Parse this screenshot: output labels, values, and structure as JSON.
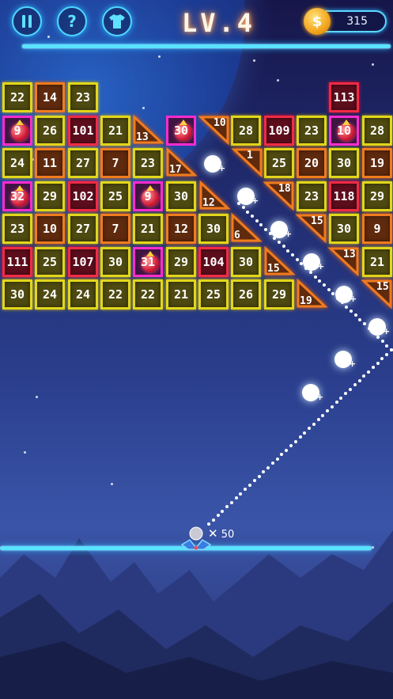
{
  "header": {
    "pause_icon": "pause-icon",
    "help_icon": "question-icon",
    "help_label": "?",
    "skins_icon": "tshirt-icon",
    "level_label": "LV.4",
    "coin_icon": "coin-icon",
    "coin_symbol": "$",
    "coins": "315"
  },
  "colors": {
    "neon_cyan": "#5ae3ff",
    "brick_yellow": "#e2d71b",
    "brick_orange": "#f07b1e",
    "brick_red": "#f02a45",
    "powerup_magenta": "#ff2bd0",
    "level_glow": "#ff7b2b"
  },
  "bricks": [
    {
      "v": "22",
      "k": "y"
    },
    {
      "v": "14",
      "k": "o"
    },
    {
      "v": "23",
      "k": "y"
    },
    {
      "v": "113",
      "k": "r"
    },
    {
      "v": "9",
      "k": "p"
    },
    {
      "v": "26",
      "k": "y"
    },
    {
      "v": "101",
      "k": "r"
    },
    {
      "v": "21",
      "k": "y"
    },
    {
      "v": "30",
      "k": "p"
    },
    {
      "v": "28",
      "k": "y"
    },
    {
      "v": "109",
      "k": "r"
    },
    {
      "v": "23",
      "k": "y"
    },
    {
      "v": "10",
      "k": "p"
    },
    {
      "v": "28",
      "k": "y"
    },
    {
      "v": "24",
      "k": "y"
    },
    {
      "v": "11",
      "k": "o"
    },
    {
      "v": "27",
      "k": "y"
    },
    {
      "v": "7",
      "k": "o"
    },
    {
      "v": "23",
      "k": "y"
    },
    {
      "v": "25",
      "k": "y"
    },
    {
      "v": "20",
      "k": "o"
    },
    {
      "v": "30",
      "k": "y"
    },
    {
      "v": "19",
      "k": "o"
    },
    {
      "v": "32",
      "k": "p"
    },
    {
      "v": "29",
      "k": "y"
    },
    {
      "v": "102",
      "k": "r"
    },
    {
      "v": "25",
      "k": "y"
    },
    {
      "v": "9",
      "k": "p"
    },
    {
      "v": "30",
      "k": "y"
    },
    {
      "v": "23",
      "k": "y"
    },
    {
      "v": "118",
      "k": "r"
    },
    {
      "v": "29",
      "k": "y"
    },
    {
      "v": "23",
      "k": "y"
    },
    {
      "v": "10",
      "k": "o"
    },
    {
      "v": "27",
      "k": "y"
    },
    {
      "v": "7",
      "k": "o"
    },
    {
      "v": "21",
      "k": "y"
    },
    {
      "v": "12",
      "k": "o"
    },
    {
      "v": "30",
      "k": "y"
    },
    {
      "v": "30",
      "k": "y"
    },
    {
      "v": "9",
      "k": "o"
    },
    {
      "v": "111",
      "k": "r"
    },
    {
      "v": "25",
      "k": "y"
    },
    {
      "v": "107",
      "k": "r"
    },
    {
      "v": "30",
      "k": "y"
    },
    {
      "v": "31",
      "k": "p"
    },
    {
      "v": "29",
      "k": "y"
    },
    {
      "v": "104",
      "k": "r"
    },
    {
      "v": "30",
      "k": "y"
    },
    {
      "v": "21",
      "k": "y"
    },
    {
      "v": "30",
      "k": "y"
    },
    {
      "v": "24",
      "k": "y"
    },
    {
      "v": "24",
      "k": "y"
    },
    {
      "v": "22",
      "k": "y"
    },
    {
      "v": "22",
      "k": "y"
    },
    {
      "v": "21",
      "k": "y"
    },
    {
      "v": "25",
      "k": "y"
    },
    {
      "v": "26",
      "k": "y"
    },
    {
      "v": "29",
      "k": "y"
    }
  ],
  "triangles": [
    {
      "v": "13"
    },
    {
      "v": "10"
    },
    {
      "v": "17"
    },
    {
      "v": "1"
    },
    {
      "v": "18"
    },
    {
      "v": "12"
    },
    {
      "v": "15"
    },
    {
      "v": "6"
    },
    {
      "v": "13"
    },
    {
      "v": "15"
    },
    {
      "v": "15"
    },
    {
      "v": "19"
    }
  ],
  "balls_in_flight": 8,
  "shooter": {
    "ball_count": "50",
    "times_symbol": "✕"
  }
}
